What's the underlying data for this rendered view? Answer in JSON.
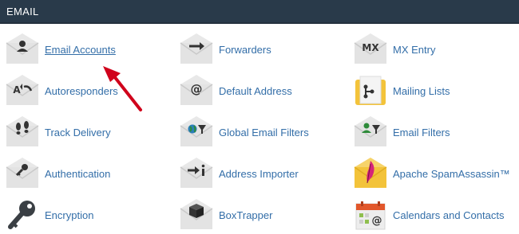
{
  "section": {
    "title": "EMAIL"
  },
  "items": [
    {
      "label": "Email Accounts",
      "icon": "user-icon"
    },
    {
      "label": "Forwarders",
      "icon": "arrow-right-icon"
    },
    {
      "label": "MX Entry",
      "icon": "mx-icon"
    },
    {
      "label": "Autoresponders",
      "icon": "autoresponder-icon"
    },
    {
      "label": "Default Address",
      "icon": "at-icon"
    },
    {
      "label": "Mailing Lists",
      "icon": "mailing-lists-icon"
    },
    {
      "label": "Track Delivery",
      "icon": "footprints-icon"
    },
    {
      "label": "Global Email Filters",
      "icon": "globe-filter-icon"
    },
    {
      "label": "Email Filters",
      "icon": "user-filter-icon"
    },
    {
      "label": "Authentication",
      "icon": "key-icon"
    },
    {
      "label": "Address Importer",
      "icon": "import-icon"
    },
    {
      "label": "Apache SpamAssassin™",
      "icon": "spamassassin-feather-icon"
    },
    {
      "label": "Encryption",
      "icon": "large-key-icon"
    },
    {
      "label": "BoxTrapper",
      "icon": "box-icon"
    },
    {
      "label": "Calendars and Contacts",
      "icon": "calendar-contacts-icon"
    }
  ],
  "colors": {
    "header_bg": "#293a4a",
    "link": "#336ea8",
    "envelope": "#e3e3e3",
    "icon_dark": "#333333",
    "arrow": "#d0021b"
  }
}
